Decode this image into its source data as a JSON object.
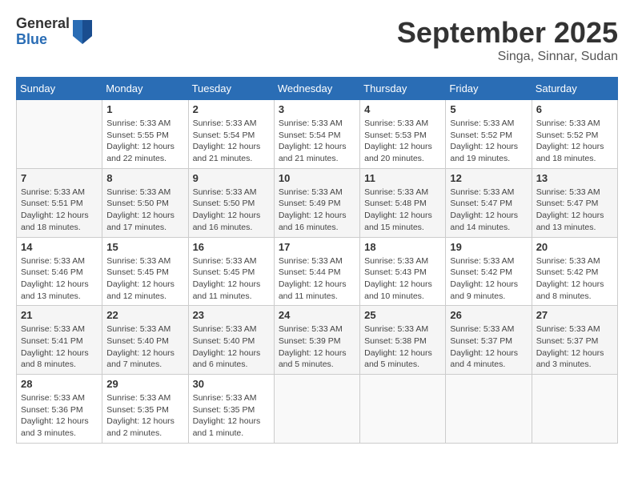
{
  "header": {
    "logo_general": "General",
    "logo_blue": "Blue",
    "month": "September 2025",
    "location": "Singa, Sinnar, Sudan"
  },
  "days_of_week": [
    "Sunday",
    "Monday",
    "Tuesday",
    "Wednesday",
    "Thursday",
    "Friday",
    "Saturday"
  ],
  "weeks": [
    [
      {
        "day": "",
        "info": ""
      },
      {
        "day": "1",
        "info": "Sunrise: 5:33 AM\nSunset: 5:55 PM\nDaylight: 12 hours\nand 22 minutes."
      },
      {
        "day": "2",
        "info": "Sunrise: 5:33 AM\nSunset: 5:54 PM\nDaylight: 12 hours\nand 21 minutes."
      },
      {
        "day": "3",
        "info": "Sunrise: 5:33 AM\nSunset: 5:54 PM\nDaylight: 12 hours\nand 21 minutes."
      },
      {
        "day": "4",
        "info": "Sunrise: 5:33 AM\nSunset: 5:53 PM\nDaylight: 12 hours\nand 20 minutes."
      },
      {
        "day": "5",
        "info": "Sunrise: 5:33 AM\nSunset: 5:52 PM\nDaylight: 12 hours\nand 19 minutes."
      },
      {
        "day": "6",
        "info": "Sunrise: 5:33 AM\nSunset: 5:52 PM\nDaylight: 12 hours\nand 18 minutes."
      }
    ],
    [
      {
        "day": "7",
        "info": "Sunrise: 5:33 AM\nSunset: 5:51 PM\nDaylight: 12 hours\nand 18 minutes."
      },
      {
        "day": "8",
        "info": "Sunrise: 5:33 AM\nSunset: 5:50 PM\nDaylight: 12 hours\nand 17 minutes."
      },
      {
        "day": "9",
        "info": "Sunrise: 5:33 AM\nSunset: 5:50 PM\nDaylight: 12 hours\nand 16 minutes."
      },
      {
        "day": "10",
        "info": "Sunrise: 5:33 AM\nSunset: 5:49 PM\nDaylight: 12 hours\nand 16 minutes."
      },
      {
        "day": "11",
        "info": "Sunrise: 5:33 AM\nSunset: 5:48 PM\nDaylight: 12 hours\nand 15 minutes."
      },
      {
        "day": "12",
        "info": "Sunrise: 5:33 AM\nSunset: 5:47 PM\nDaylight: 12 hours\nand 14 minutes."
      },
      {
        "day": "13",
        "info": "Sunrise: 5:33 AM\nSunset: 5:47 PM\nDaylight: 12 hours\nand 13 minutes."
      }
    ],
    [
      {
        "day": "14",
        "info": "Sunrise: 5:33 AM\nSunset: 5:46 PM\nDaylight: 12 hours\nand 13 minutes."
      },
      {
        "day": "15",
        "info": "Sunrise: 5:33 AM\nSunset: 5:45 PM\nDaylight: 12 hours\nand 12 minutes."
      },
      {
        "day": "16",
        "info": "Sunrise: 5:33 AM\nSunset: 5:45 PM\nDaylight: 12 hours\nand 11 minutes."
      },
      {
        "day": "17",
        "info": "Sunrise: 5:33 AM\nSunset: 5:44 PM\nDaylight: 12 hours\nand 11 minutes."
      },
      {
        "day": "18",
        "info": "Sunrise: 5:33 AM\nSunset: 5:43 PM\nDaylight: 12 hours\nand 10 minutes."
      },
      {
        "day": "19",
        "info": "Sunrise: 5:33 AM\nSunset: 5:42 PM\nDaylight: 12 hours\nand 9 minutes."
      },
      {
        "day": "20",
        "info": "Sunrise: 5:33 AM\nSunset: 5:42 PM\nDaylight: 12 hours\nand 8 minutes."
      }
    ],
    [
      {
        "day": "21",
        "info": "Sunrise: 5:33 AM\nSunset: 5:41 PM\nDaylight: 12 hours\nand 8 minutes."
      },
      {
        "day": "22",
        "info": "Sunrise: 5:33 AM\nSunset: 5:40 PM\nDaylight: 12 hours\nand 7 minutes."
      },
      {
        "day": "23",
        "info": "Sunrise: 5:33 AM\nSunset: 5:40 PM\nDaylight: 12 hours\nand 6 minutes."
      },
      {
        "day": "24",
        "info": "Sunrise: 5:33 AM\nSunset: 5:39 PM\nDaylight: 12 hours\nand 5 minutes."
      },
      {
        "day": "25",
        "info": "Sunrise: 5:33 AM\nSunset: 5:38 PM\nDaylight: 12 hours\nand 5 minutes."
      },
      {
        "day": "26",
        "info": "Sunrise: 5:33 AM\nSunset: 5:37 PM\nDaylight: 12 hours\nand 4 minutes."
      },
      {
        "day": "27",
        "info": "Sunrise: 5:33 AM\nSunset: 5:37 PM\nDaylight: 12 hours\nand 3 minutes."
      }
    ],
    [
      {
        "day": "28",
        "info": "Sunrise: 5:33 AM\nSunset: 5:36 PM\nDaylight: 12 hours\nand 3 minutes."
      },
      {
        "day": "29",
        "info": "Sunrise: 5:33 AM\nSunset: 5:35 PM\nDaylight: 12 hours\nand 2 minutes."
      },
      {
        "day": "30",
        "info": "Sunrise: 5:33 AM\nSunset: 5:35 PM\nDaylight: 12 hours\nand 1 minute."
      },
      {
        "day": "",
        "info": ""
      },
      {
        "day": "",
        "info": ""
      },
      {
        "day": "",
        "info": ""
      },
      {
        "day": "",
        "info": ""
      }
    ]
  ]
}
